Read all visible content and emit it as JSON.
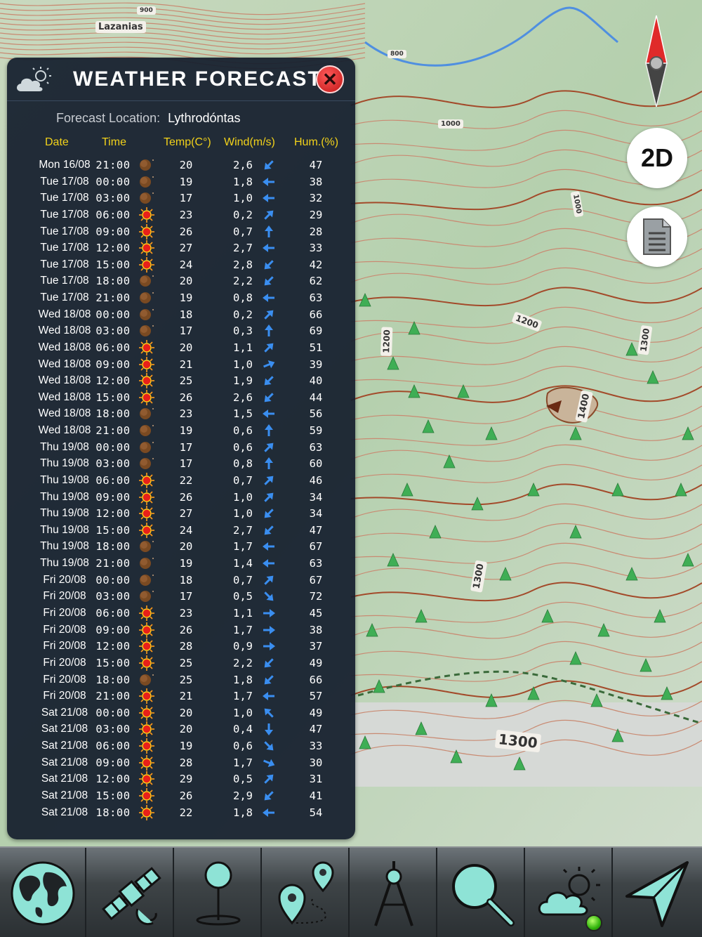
{
  "map": {
    "labels": [
      "Lazanias",
      "900",
      "800",
      "1000",
      "1000",
      "1200",
      "1200",
      "1300",
      "1300",
      "1400",
      "1300",
      "1300"
    ],
    "colors": {
      "terrain": "#b9d2b0",
      "contour": "#c98a72",
      "index_contour": "#a34a2a",
      "tree": "#3fae55"
    }
  },
  "panel": {
    "title": "WEATHER FORECAST",
    "header_icon": "weather-cloud-sun-icon",
    "close_icon": "close-x-icon",
    "location_label": "Forecast Location:",
    "location_value": "Lythrodóntas",
    "columns": {
      "date": "Date",
      "time": "Time",
      "temp": "Temp(C°)",
      "wind": "Wind(m/s)",
      "hum": "Hum.(%)"
    }
  },
  "forecast": [
    {
      "date": "Mon 16/08",
      "time": "21:00",
      "icon": "moon",
      "temp": "20",
      "wind": "2,6",
      "dir": "SW",
      "hum": "47"
    },
    {
      "date": "Tue 17/08",
      "time": "00:00",
      "icon": "moon",
      "temp": "19",
      "wind": "1,8",
      "dir": "W",
      "hum": "38"
    },
    {
      "date": "Tue 17/08",
      "time": "03:00",
      "icon": "moon",
      "temp": "17",
      "wind": "1,0",
      "dir": "W",
      "hum": "32"
    },
    {
      "date": "Tue 17/08",
      "time": "06:00",
      "icon": "sun",
      "temp": "23",
      "wind": "0,2",
      "dir": "NE",
      "hum": "29"
    },
    {
      "date": "Tue 17/08",
      "time": "09:00",
      "icon": "sun",
      "temp": "26",
      "wind": "0,7",
      "dir": "N",
      "hum": "28"
    },
    {
      "date": "Tue 17/08",
      "time": "12:00",
      "icon": "sun",
      "temp": "27",
      "wind": "2,7",
      "dir": "W",
      "hum": "33"
    },
    {
      "date": "Tue 17/08",
      "time": "15:00",
      "icon": "sun",
      "temp": "24",
      "wind": "2,8",
      "dir": "SW",
      "hum": "42"
    },
    {
      "date": "Tue 17/08",
      "time": "18:00",
      "icon": "moon",
      "temp": "20",
      "wind": "2,2",
      "dir": "SW",
      "hum": "62"
    },
    {
      "date": "Tue 17/08",
      "time": "21:00",
      "icon": "moon",
      "temp": "19",
      "wind": "0,8",
      "dir": "W",
      "hum": "63"
    },
    {
      "date": "Wed 18/08",
      "time": "00:00",
      "icon": "moon",
      "temp": "18",
      "wind": "0,2",
      "dir": "NE",
      "hum": "66"
    },
    {
      "date": "Wed 18/08",
      "time": "03:00",
      "icon": "moon",
      "temp": "17",
      "wind": "0,3",
      "dir": "N",
      "hum": "69"
    },
    {
      "date": "Wed 18/08",
      "time": "06:00",
      "icon": "sun",
      "temp": "20",
      "wind": "1,1",
      "dir": "NE",
      "hum": "51"
    },
    {
      "date": "Wed 18/08",
      "time": "09:00",
      "icon": "sun",
      "temp": "21",
      "wind": "1,0",
      "dir": "ENE",
      "hum": "39"
    },
    {
      "date": "Wed 18/08",
      "time": "12:00",
      "icon": "sun",
      "temp": "25",
      "wind": "1,9",
      "dir": "SW",
      "hum": "40"
    },
    {
      "date": "Wed 18/08",
      "time": "15:00",
      "icon": "sun",
      "temp": "26",
      "wind": "2,6",
      "dir": "SW",
      "hum": "44"
    },
    {
      "date": "Wed 18/08",
      "time": "18:00",
      "icon": "moon",
      "temp": "23",
      "wind": "1,5",
      "dir": "W",
      "hum": "56"
    },
    {
      "date": "Wed 18/08",
      "time": "21:00",
      "icon": "moon",
      "temp": "19",
      "wind": "0,6",
      "dir": "N",
      "hum": "59"
    },
    {
      "date": "Thu 19/08",
      "time": "00:00",
      "icon": "moon",
      "temp": "17",
      "wind": "0,6",
      "dir": "NE",
      "hum": "63"
    },
    {
      "date": "Thu 19/08",
      "time": "03:00",
      "icon": "moon",
      "temp": "17",
      "wind": "0,8",
      "dir": "N",
      "hum": "60"
    },
    {
      "date": "Thu 19/08",
      "time": "06:00",
      "icon": "sun",
      "temp": "22",
      "wind": "0,7",
      "dir": "NE",
      "hum": "46"
    },
    {
      "date": "Thu 19/08",
      "time": "09:00",
      "icon": "sun",
      "temp": "26",
      "wind": "1,0",
      "dir": "NE",
      "hum": "34"
    },
    {
      "date": "Thu 19/08",
      "time": "12:00",
      "icon": "sun",
      "temp": "27",
      "wind": "1,0",
      "dir": "SW",
      "hum": "34"
    },
    {
      "date": "Thu 19/08",
      "time": "15:00",
      "icon": "sun",
      "temp": "24",
      "wind": "2,7",
      "dir": "SW",
      "hum": "47"
    },
    {
      "date": "Thu 19/08",
      "time": "18:00",
      "icon": "moon",
      "temp": "20",
      "wind": "1,7",
      "dir": "W",
      "hum": "67"
    },
    {
      "date": "Thu 19/08",
      "time": "21:00",
      "icon": "moon",
      "temp": "19",
      "wind": "1,4",
      "dir": "W",
      "hum": "63"
    },
    {
      "date": "Fri 20/08",
      "time": "00:00",
      "icon": "moon",
      "temp": "18",
      "wind": "0,7",
      "dir": "NE",
      "hum": "67"
    },
    {
      "date": "Fri 20/08",
      "time": "03:00",
      "icon": "moon",
      "temp": "17",
      "wind": "0,5",
      "dir": "SE",
      "hum": "72"
    },
    {
      "date": "Fri 20/08",
      "time": "06:00",
      "icon": "sun",
      "temp": "23",
      "wind": "1,1",
      "dir": "E",
      "hum": "45"
    },
    {
      "date": "Fri 20/08",
      "time": "09:00",
      "icon": "sun",
      "temp": "26",
      "wind": "1,7",
      "dir": "E",
      "hum": "38"
    },
    {
      "date": "Fri 20/08",
      "time": "12:00",
      "icon": "sun",
      "temp": "28",
      "wind": "0,9",
      "dir": "E",
      "hum": "37"
    },
    {
      "date": "Fri 20/08",
      "time": "15:00",
      "icon": "sun",
      "temp": "25",
      "wind": "2,2",
      "dir": "SW",
      "hum": "49"
    },
    {
      "date": "Fri 20/08",
      "time": "18:00",
      "icon": "moon",
      "temp": "25",
      "wind": "1,8",
      "dir": "SW",
      "hum": "66"
    },
    {
      "date": "Fri 20/08",
      "time": "21:00",
      "icon": "sun",
      "temp": "21",
      "wind": "1,7",
      "dir": "W",
      "hum": "57"
    },
    {
      "date": "Sat 21/08",
      "time": "00:00",
      "icon": "sun",
      "temp": "20",
      "wind": "1,0",
      "dir": "NW",
      "hum": "49"
    },
    {
      "date": "Sat 21/08",
      "time": "03:00",
      "icon": "sun",
      "temp": "20",
      "wind": "0,4",
      "dir": "S",
      "hum": "47"
    },
    {
      "date": "Sat 21/08",
      "time": "06:00",
      "icon": "sun",
      "temp": "19",
      "wind": "0,6",
      "dir": "SE",
      "hum": "33"
    },
    {
      "date": "Sat 21/08",
      "time": "09:00",
      "icon": "sun",
      "temp": "28",
      "wind": "1,7",
      "dir": "ESE",
      "hum": "30"
    },
    {
      "date": "Sat 21/08",
      "time": "12:00",
      "icon": "sun",
      "temp": "29",
      "wind": "0,5",
      "dir": "NE",
      "hum": "31"
    },
    {
      "date": "Sat 21/08",
      "time": "15:00",
      "icon": "sun",
      "temp": "26",
      "wind": "2,9",
      "dir": "SW",
      "hum": "41"
    },
    {
      "date": "Sat 21/08",
      "time": "18:00",
      "icon": "sun",
      "temp": "22",
      "wind": "1,8",
      "dir": "W",
      "hum": "54"
    }
  ],
  "controls": {
    "compass_icon": "compass-needle-icon",
    "mode_label": "2D",
    "doc_icon": "document-icon"
  },
  "toolbar": {
    "items": [
      {
        "name": "globe-icon"
      },
      {
        "name": "satellite-icon"
      },
      {
        "name": "pin-icon"
      },
      {
        "name": "route-pins-icon"
      },
      {
        "name": "compass-divider-icon"
      },
      {
        "name": "search-icon"
      },
      {
        "name": "weather-icon"
      },
      {
        "name": "navigate-arrow-icon"
      }
    ],
    "icon_color": "#8ee3d6",
    "status_color": "#32b50d"
  }
}
